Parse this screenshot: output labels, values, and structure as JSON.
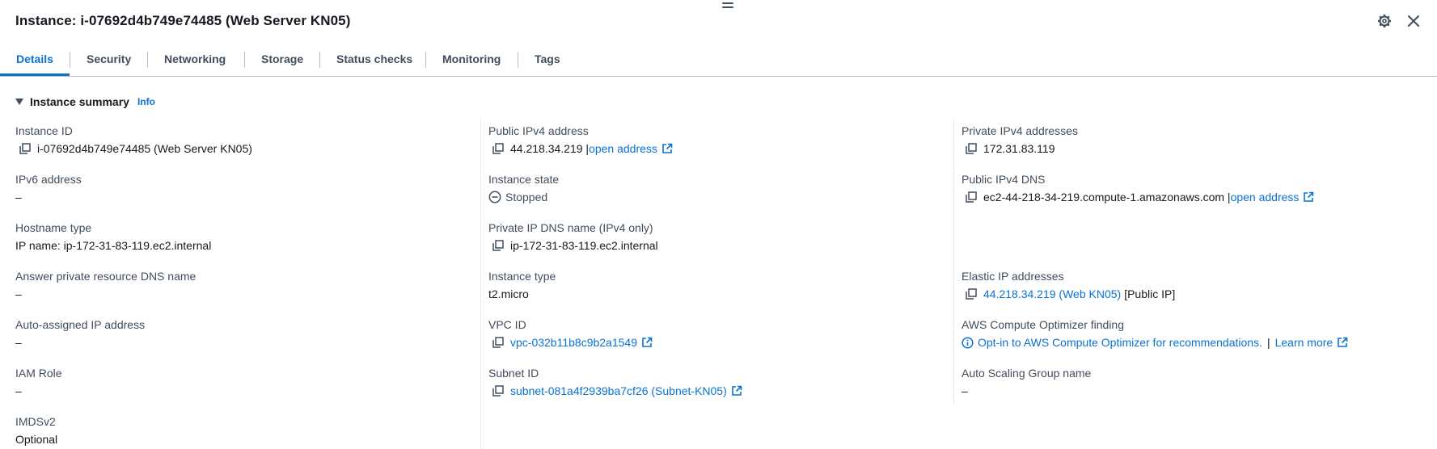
{
  "header": {
    "title": "Instance: i-07692d4b749e74485 (Web Server KN05)"
  },
  "tabs": [
    {
      "label": "Details",
      "active": true
    },
    {
      "label": "Security"
    },
    {
      "label": "Networking"
    },
    {
      "label": "Storage"
    },
    {
      "label": "Status checks"
    },
    {
      "label": "Monitoring"
    },
    {
      "label": "Tags"
    }
  ],
  "summary": {
    "title": "Instance summary",
    "info": "Info"
  },
  "fields": {
    "instance_id": {
      "label": "Instance ID",
      "value": "i-07692d4b749e74485 (Web Server KN05)"
    },
    "ipv6": {
      "label": "IPv6 address",
      "value": "–"
    },
    "hostname_type": {
      "label": "Hostname type",
      "value": "IP name: ip-172-31-83-119.ec2.internal"
    },
    "answer_dns": {
      "label": "Answer private resource DNS name",
      "value": "–"
    },
    "auto_ip": {
      "label": "Auto-assigned IP address",
      "value": "–"
    },
    "iam_role": {
      "label": "IAM Role",
      "value": "–"
    },
    "imdsv2": {
      "label": "IMDSv2",
      "value": "Optional"
    },
    "public_ipv4": {
      "label": "Public IPv4 address",
      "value": "44.218.34.219 |",
      "link": "open address"
    },
    "instance_state": {
      "label": "Instance state",
      "value": "Stopped"
    },
    "private_dns": {
      "label": "Private IP DNS name (IPv4 only)",
      "value": "ip-172-31-83-119.ec2.internal"
    },
    "instance_type": {
      "label": "Instance type",
      "value": "t2.micro"
    },
    "vpc_id": {
      "label": "VPC ID",
      "value": "vpc-032b11b8c9b2a1549"
    },
    "subnet_id": {
      "label": "Subnet ID",
      "value": "subnet-081a4f2939ba7cf26 (Subnet-KN05)"
    },
    "private_ipv4": {
      "label": "Private IPv4 addresses",
      "value": "172.31.83.119"
    },
    "public_dns": {
      "label": "Public IPv4 DNS",
      "value": "ec2-44-218-34-219.compute-1.amazonaws.com |",
      "link": "open address"
    },
    "elastic_ip": {
      "label": "Elastic IP addresses",
      "link": "44.218.34.219 (Web KN05)",
      "suffix": "[Public IP]"
    },
    "optimizer": {
      "label": "AWS Compute Optimizer finding",
      "link": "Opt-in to AWS Compute Optimizer for recommendations.",
      "sep": "|",
      "learn": "Learn more"
    },
    "asg": {
      "label": "Auto Scaling Group name",
      "value": "–"
    }
  },
  "colors": {
    "accent": "#0972d3",
    "text": "#16191f",
    "muted": "#414d5c",
    "divider": "#b6bec9"
  }
}
